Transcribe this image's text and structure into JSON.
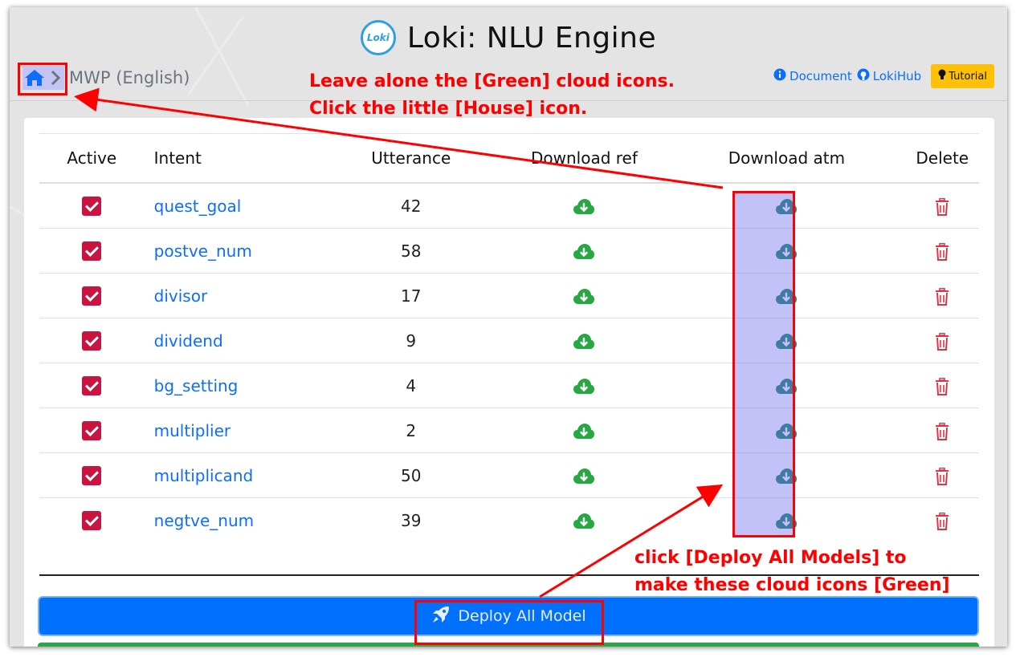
{
  "app": {
    "title": "Loki: NLU Engine",
    "logo_text": "Loki"
  },
  "breadcrumb": {
    "current": "MWP (English)"
  },
  "toplinks": {
    "document": "Document",
    "lokihub": "LokiHub",
    "tutorial": "Tutorial"
  },
  "table": {
    "headers": {
      "active": "Active",
      "intent": "Intent",
      "utterance": "Utterance",
      "download_ref": "Download ref",
      "download_atm": "Download atm",
      "delete": "Delete"
    },
    "rows": [
      {
        "intent": "quest_goal",
        "utterance": "42"
      },
      {
        "intent": "postve_num",
        "utterance": "58"
      },
      {
        "intent": "divisor",
        "utterance": "17"
      },
      {
        "intent": "dividend",
        "utterance": "9"
      },
      {
        "intent": "bg_setting",
        "utterance": "4"
      },
      {
        "intent": "multiplier",
        "utterance": "2"
      },
      {
        "intent": "multiplicand",
        "utterance": "50"
      },
      {
        "intent": "negtve_num",
        "utterance": "39"
      }
    ]
  },
  "deploy": {
    "label": "Deploy All Model"
  },
  "annotations": {
    "top_line1": "Leave alone the [Green] cloud icons.",
    "top_line2": "Click the little [House] icon.",
    "bottom_line1": "click [Deploy All Models] to",
    "bottom_line2": "make these cloud icons [Green]"
  },
  "colors": {
    "link": "#0d6efd",
    "checkbox": "#c8143f",
    "cloud_ref": "#28a745",
    "cloud_atm": "#20866b",
    "trash": "#dc3545",
    "deploy": "#0070ff",
    "tutorial": "#ffc107",
    "annotation": "#ff0000"
  },
  "icons": {
    "home": "home-icon",
    "chevron": "chevron-right-icon",
    "document": "info-circle-icon",
    "lokihub": "github-icon",
    "tutorial": "lightbulb-icon",
    "download_ref": "cloud-download-icon",
    "download_atm": "cloud-download-icon",
    "delete": "trash-icon",
    "deploy": "rocket-icon"
  }
}
